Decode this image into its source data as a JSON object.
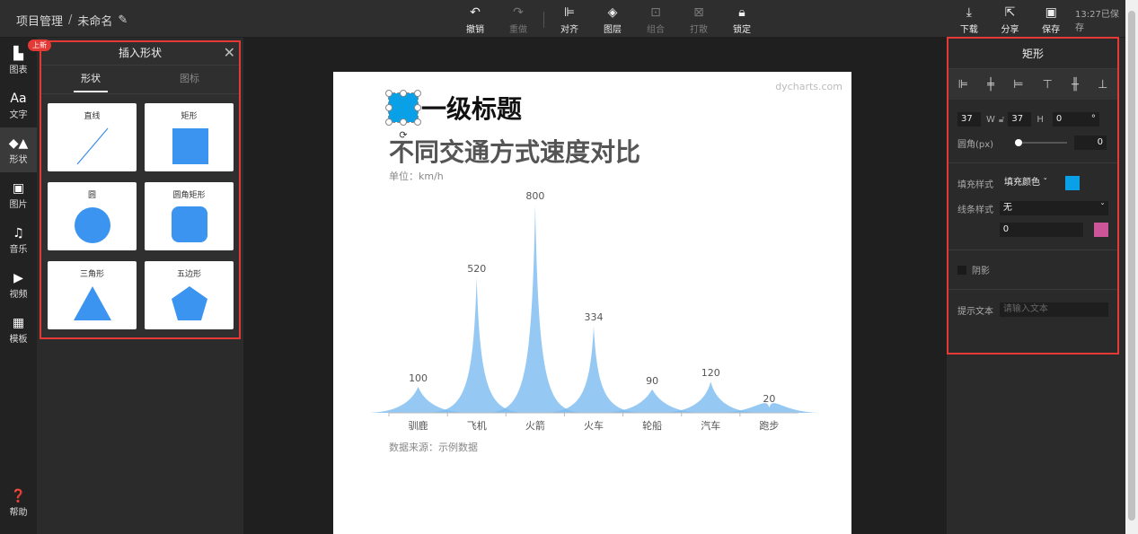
{
  "topbar": {
    "breadcrumb_root": "项目管理",
    "breadcrumb_sep": "/",
    "doc_name": "未命名",
    "tools": [
      {
        "icon": "↶",
        "label": "撤销",
        "disabled": false
      },
      {
        "icon": "↷",
        "label": "重做",
        "disabled": true
      },
      {
        "icon": "⊫",
        "label": "对齐",
        "disabled": false
      },
      {
        "icon": "◈",
        "label": "图层",
        "disabled": false
      },
      {
        "icon": "⊡",
        "label": "组合",
        "disabled": true
      },
      {
        "icon": "⊠",
        "label": "打散",
        "disabled": true
      },
      {
        "icon": "🔒︎",
        "label": "锁定",
        "disabled": false
      }
    ],
    "download": "下载",
    "share": "分享",
    "save": "保存",
    "saved_status": "13:27已保存"
  },
  "leftbar": {
    "items": [
      {
        "icon": "▙",
        "label": "图表"
      },
      {
        "icon": "Aa",
        "label": "文字"
      },
      {
        "icon": "◆▲",
        "label": "形状"
      },
      {
        "icon": "▣",
        "label": "图片"
      },
      {
        "icon": "♫",
        "label": "音乐"
      },
      {
        "icon": "▶",
        "label": "视频"
      },
      {
        "icon": "▦",
        "label": "模板"
      }
    ],
    "help": "帮助"
  },
  "shape_panel": {
    "badge": "上新",
    "title": "插入形状",
    "tab_shape": "形状",
    "tab_icon": "图标",
    "shapes": [
      "直线",
      "矩形",
      "圆",
      "圆角矩形",
      "三角形",
      "五边形"
    ]
  },
  "canvas": {
    "watermark": "dycharts.com",
    "heading": "一级标题",
    "unit": "单位：km/h",
    "source": "数据来源：示例数据"
  },
  "chart_data": {
    "type": "area",
    "title": "不同交通方式速度对比",
    "categories": [
      "驯鹿",
      "飞机",
      "火箭",
      "火车",
      "轮船",
      "汽车",
      "跑步"
    ],
    "values": [
      100,
      520,
      800,
      334,
      90,
      120,
      20
    ],
    "ylim": [
      0,
      800
    ],
    "color": "#7bbcf0",
    "grid": false
  },
  "props": {
    "title": "矩形",
    "w": "37",
    "w_label": "W",
    "h": "37",
    "h_label": "H",
    "rotation": "0",
    "deg": "°",
    "radius_label": "圆角(px)",
    "radius": "0",
    "fill_label": "填充样式",
    "fill_value": "填充颜色",
    "fill_color": "#0aa0e8",
    "stroke_label": "线条样式",
    "stroke_value": "无",
    "stroke_width": "0",
    "stroke_color": "#cc5599",
    "shadow_label": "阴影",
    "hint_label": "提示文本",
    "hint_placeholder": "请输入文本"
  }
}
